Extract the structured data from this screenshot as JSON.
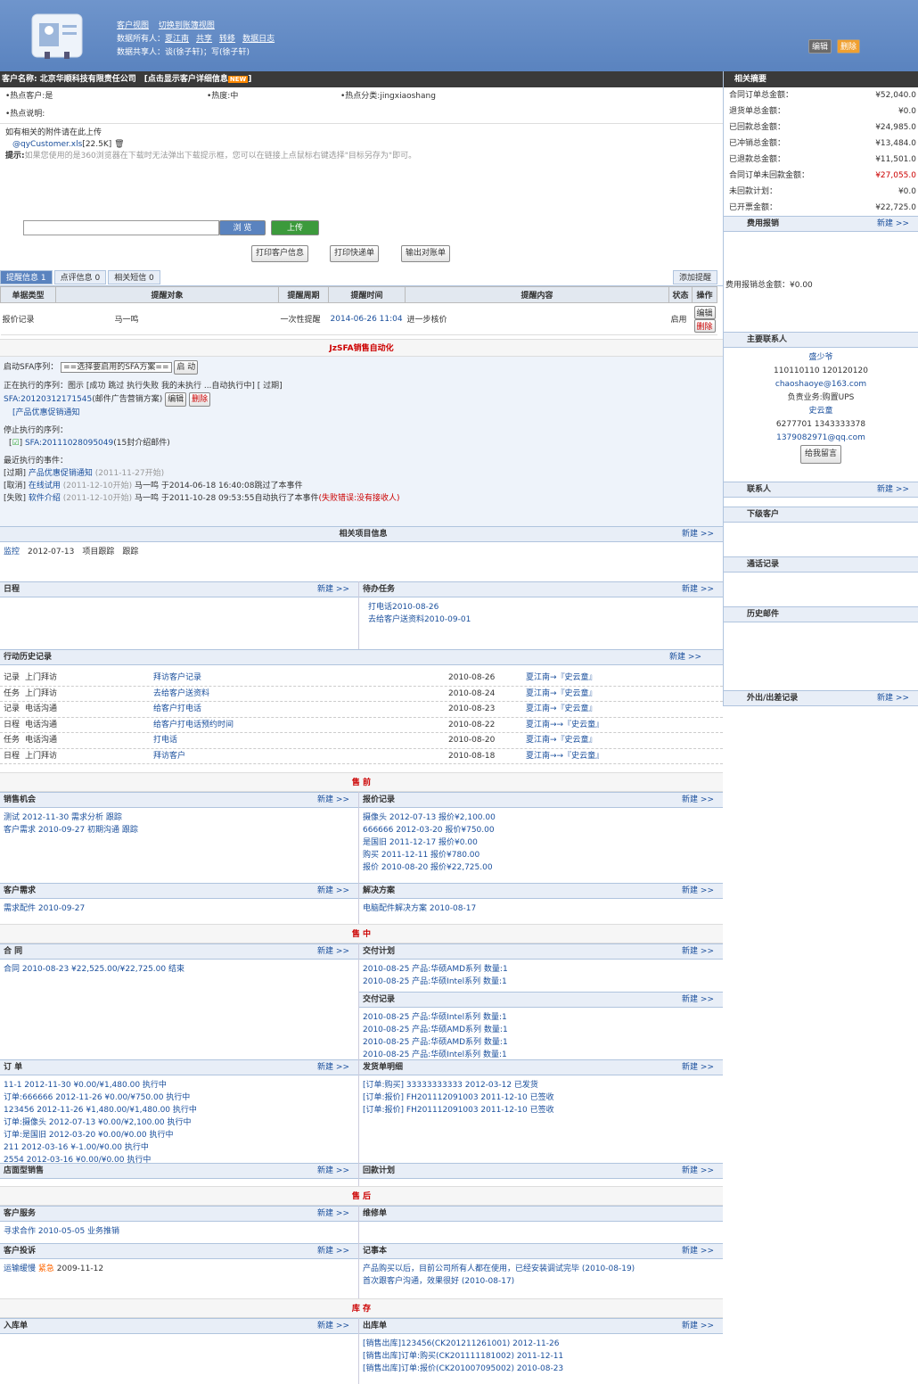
{
  "header": {
    "nav1": "客户视图",
    "nav2": "切换到账簿视图",
    "owner_label": "数据所有人：",
    "owner": "夏江南",
    "share": "共享",
    "transfer": "转移",
    "log": "数据日志",
    "sharers_label": "数据共享人：",
    "sharers": "谈(徐子轩)；写(徐子轩)",
    "edit": "编辑",
    "delete": "删除"
  },
  "customer": {
    "name_label": "客户名称:",
    "name": "北京华顺科技有限责任公司",
    "detail_link": "[点击显示客户详细信息",
    "new_badge": "NEW",
    "hot_label": "•热点客户:",
    "hot": "是",
    "heat_label": "•热度:",
    "heat": "中",
    "hotcat_label": "•热点分类:",
    "hotcat": "jingxiaoshang",
    "hotdesc_label": "•热点说明:"
  },
  "attach": {
    "title": "如有相关的附件请在此上传",
    "file": "@qyCustomer.xls",
    "size": "[22.5K]",
    "tip_label": "提示:",
    "tip": "如果您使用的是360浏览器在下载时无法弹出下载提示框，您可以在链接上点鼠标右键选择\"目标另存为\"即可。",
    "browse": "浏 览",
    "upload": "上传",
    "print_info": "打印客户信息",
    "print_express": "打印快递单",
    "export": "输出对账单"
  },
  "reminder": {
    "tabs": [
      "提醒信息 1",
      "点评信息 0",
      "相关短信 0"
    ],
    "add": "添加提醒",
    "headers": [
      "单据类型",
      "提醒对象",
      "提醒周期",
      "提醒时间",
      "提醒内容",
      "状态",
      "操作"
    ],
    "row": {
      "type": "报价记录",
      "target": "马一鸣",
      "cycle": "一次性提醒",
      "time": "2014-06-26 11:04",
      "content": "进一步核价",
      "status": "启用",
      "edit": "编辑",
      "del": "删除"
    }
  },
  "sfa": {
    "title": "JzSFA销售自动化",
    "start_label": "启动SFA序列：",
    "select": "==选择要启用的SFA方案==",
    "start_btn": "启 动",
    "running_label": "正在执行的序列：",
    "legend": "图示 [成功 跳过 执行失败 我的未执行 ...自动执行中] [ 过期]",
    "seq": "SFA:20120312171545",
    "seq_note": "(邮件广告营销方案)",
    "edit": "编辑",
    "del": "删除",
    "notice": "[产品优惠促销通知",
    "stopped_label": "停止执行的序列：",
    "stopped": "SFA:20111028095049",
    "stopped_note": "(15封介绍邮件)",
    "events_label": "最近执行的事件：",
    "events": [
      {
        "tag": "[过期]",
        "name": "产品优惠促销通知",
        "date": "(2011-11-27开始)",
        "info": "",
        "err": ""
      },
      {
        "tag": "[取消]",
        "name": "在线试用",
        "date": "(2011-12-10开始)",
        "info": "马一鸣 于2014-06-18 16:40:08跳过了本事件",
        "err": ""
      },
      {
        "tag": "[失败]",
        "name": "软件介绍",
        "date": "(2011-12-10开始)",
        "info": "马一鸣 于2011-10-28 09:53:55自动执行了本事件",
        "err": "(失败错误:没有接收人)"
      }
    ]
  },
  "project": {
    "title": "相关项目信息",
    "new": "新建 >>",
    "item": "监控",
    "date": "2012-07-13",
    "type": "项目跟踪",
    "state": "跟踪"
  },
  "schedule": {
    "title": "日程",
    "new": "新建 >>"
  },
  "todo": {
    "title": "待办任务",
    "new": "新建 >>",
    "items": [
      "打电话2010-08-26",
      "去给客户送资料2010-09-01"
    ]
  },
  "history": {
    "title": "行动历史记录",
    "new": "新建 >>",
    "rows": [
      {
        "a": "记录",
        "b": "上门拜访",
        "c": "拜访客户记录",
        "d": "2010-08-26",
        "e": "夏江南→『史云童』"
      },
      {
        "a": "任务",
        "b": "上门拜访",
        "c": "去给客户送资料",
        "d": "2010-08-24",
        "e": "夏江南→『史云童』"
      },
      {
        "a": "记录",
        "b": "电话沟通",
        "c": "给客户打电话",
        "d": "2010-08-23",
        "e": "夏江南→『史云童』"
      },
      {
        "a": "日程",
        "b": "电话沟通",
        "c": "给客户打电话预约时间",
        "d": "2010-08-22",
        "e": "夏江南→→『史云童』"
      },
      {
        "a": "任务",
        "b": "电话沟通",
        "c": "打电话",
        "d": "2010-08-20",
        "e": "夏江南→『史云童』"
      },
      {
        "a": "日程",
        "b": "上门拜访",
        "c": "拜访客户",
        "d": "2010-08-18",
        "e": "夏江南→→『史云童』"
      }
    ]
  },
  "cats": {
    "pre": "售 前",
    "mid": "售 中",
    "post": "售 后",
    "stock": "库 存"
  },
  "chance": {
    "title": "销售机会",
    "new": "新建 >>",
    "items": [
      "测试  2012-11-30  需求分析 跟踪",
      "客户需求  2010-09-27  初期沟通 跟踪"
    ]
  },
  "quote": {
    "title": "报价记录",
    "new": "新建 >>",
    "items": [
      "摄像头 2012-07-13  报价¥2,100.00",
      "666666 2012-03-20  报价¥750.00",
      "是国旧 2011-12-17  报价¥0.00",
      "购买 2011-12-11  报价¥780.00",
      "报价  2010-08-20  报价¥22,725.00"
    ]
  },
  "demand": {
    "title": "客户需求",
    "new": "新建 >>",
    "item": "需求配件  2010-09-27"
  },
  "solution": {
    "title": "解决方案",
    "new": "新建 >>",
    "item": "电脑配件解决方案 2010-08-17"
  },
  "contract": {
    "title": "合 同",
    "new": "新建 >>",
    "item": "合同  2010-08-23  ¥22,525.00/¥22,725.00 结束"
  },
  "delivery": {
    "title": "交付计划",
    "new": "新建 >>",
    "items": [
      "2010-08-25  产品:华硕AMD系列 数量:1",
      "2010-08-25  产品:华硕Intel系列 数量:1"
    ]
  },
  "delrec": {
    "title": "交付记录",
    "new": "新建 >>",
    "items": [
      "2010-08-25  产品:华硕Intel系列 数量:1",
      "2010-08-25  产品:华硕AMD系列 数量:1",
      "2010-08-25  产品:华硕AMD系列 数量:1",
      "2010-08-25  产品:华硕Intel系列 数量:1"
    ]
  },
  "order": {
    "title": "订 单",
    "new": "新建 >>",
    "items": [
      "11-1  2012-11-30  ¥0.00/¥1,480.00 执行中",
      "订单:666666  2012-11-26  ¥0.00/¥750.00 执行中",
      "123456  2012-11-26  ¥1,480.00/¥1,480.00 执行中",
      "订单:摄像头  2012-07-13  ¥0.00/¥2,100.00 执行中",
      "订单:是国旧  2012-03-20  ¥0.00/¥0.00 执行中",
      "211  2012-03-16  ¥-1.00/¥0.00 执行中",
      "2554  2012-03-16  ¥0.00/¥0.00 执行中"
    ]
  },
  "ship": {
    "title": "发货单明细",
    "new": "新建 >>",
    "items": [
      "[订单:购买]  33333333333 2012-03-12 已发货",
      "[订单:报价]  FH201112091003 2011-12-10 已签收",
      "[订单:报价]  FH201112091003 2011-12-10 已签收"
    ]
  },
  "store": {
    "title": "店面型销售",
    "new": "新建 >>"
  },
  "payplan": {
    "title": "回款计划",
    "new": "新建 >>"
  },
  "service": {
    "title": "客户服务",
    "new": "新建 >>",
    "item": "寻求合作  2010-05-05  业务推销"
  },
  "repair": {
    "title": "维修单"
  },
  "complaint": {
    "title": "客户投诉",
    "new": "新建 >>",
    "item": "运输缓慢",
    "level": "紧急",
    "date": "2009-11-12"
  },
  "memo": {
    "title": "记事本",
    "new": "新建 >>",
    "items": [
      "产品购买以后，目前公司所有人都在使用，已经安装调试完毕 (2010-08-19)",
      "首次跟客户沟通，效果很好 (2010-08-17)"
    ]
  },
  "instock": {
    "title": "入库单",
    "new": "新建 >>"
  },
  "outstock": {
    "title": "出库单",
    "new": "新建 >>",
    "items": [
      "[销售出库]123456(CK201211261001)  2012-11-26",
      "[销售出库]订单:购买(CK201111181002)  2011-12-11",
      "[销售出库]订单:报价(CK201007095002)  2010-08-23"
    ]
  },
  "summary": {
    "title": "相关摘要",
    "rows": [
      [
        "合同订单总金额：",
        "¥52,040.0"
      ],
      [
        "退货单总金额：",
        "¥0.0"
      ],
      [
        "已回款总金额：",
        "¥24,985.0"
      ],
      [
        "已冲销总金额：",
        "¥13,484.0"
      ],
      [
        "已退款总金额：",
        "¥11,501.0"
      ],
      [
        "合同订单未回款金额：",
        "¥27,055.0"
      ],
      [
        "未回款计划：",
        "¥0.0"
      ],
      [
        "已开票金额：",
        "¥22,725.0"
      ]
    ]
  },
  "expense": {
    "title": "费用报销",
    "new": "新建 >>",
    "total": "费用报销总金额：¥0.00"
  },
  "contacts": {
    "title": "主要联系人",
    "c1": "盛少爷",
    "p1": "110110110    120120120",
    "e1": "chaoshaoye@163.com",
    "r1": "负责业务:购置UPS",
    "c2": "史云童",
    "p2": "6277701    1343333378",
    "e2": "1379082971@qq.com",
    "msg": "给我留言"
  },
  "linkman": {
    "title": "联系人",
    "new": "新建 >>"
  },
  "sub": {
    "title": "下级客户"
  },
  "calls": {
    "title": "通话记录"
  },
  "mails": {
    "title": "历史邮件"
  },
  "trip": {
    "title": "外出/出差记录",
    "new": "新建 >>"
  }
}
